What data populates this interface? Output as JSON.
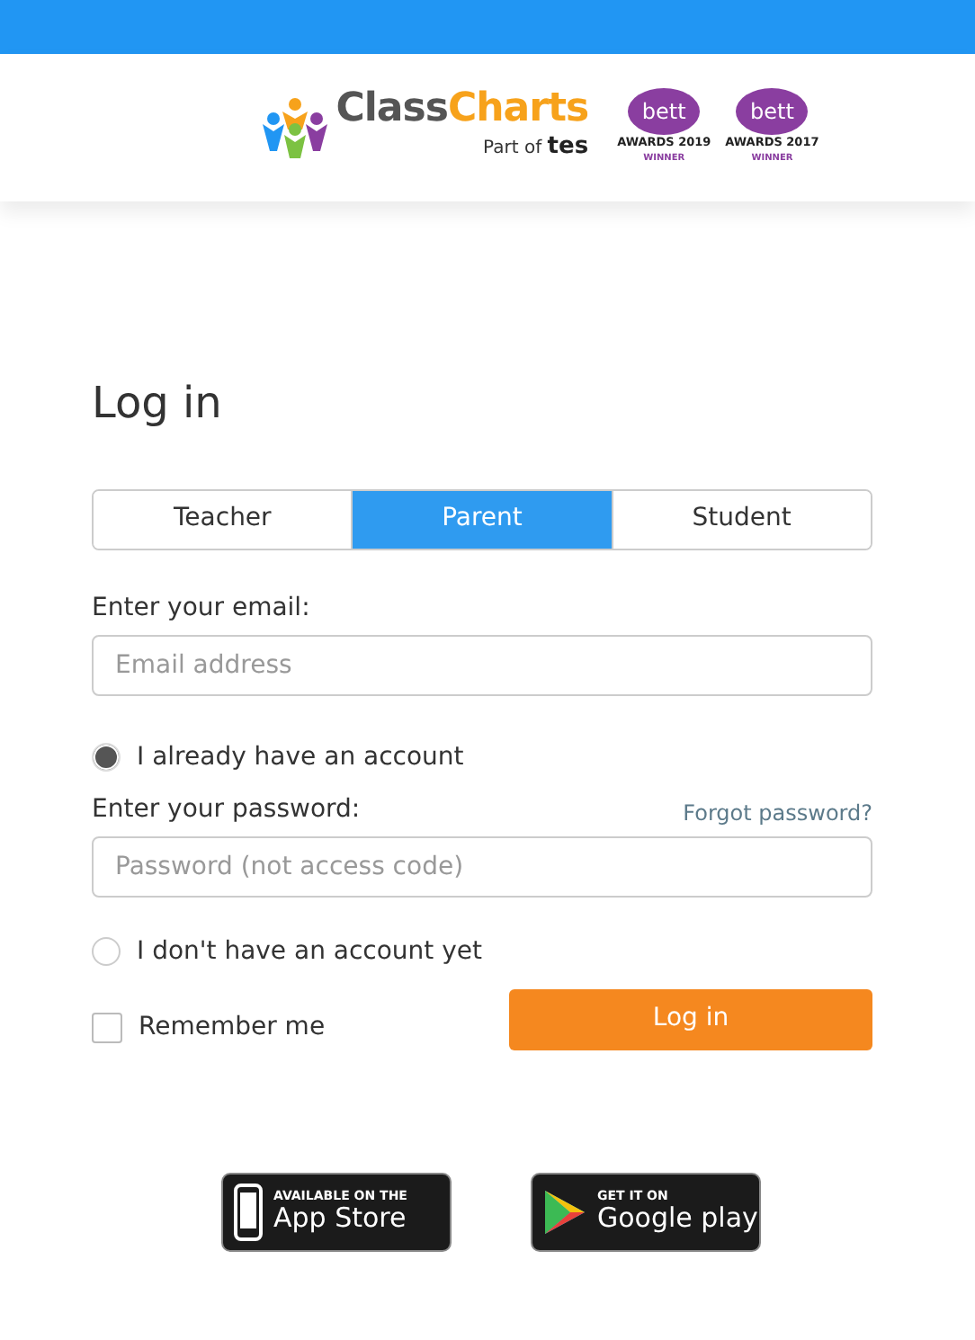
{
  "header": {
    "brand": [
      "Class",
      "Charts"
    ],
    "tagline": [
      "Part of",
      "tes"
    ],
    "awards": [
      {
        "name": "bett",
        "year": "AWARDS 2019",
        "note": "WINNER"
      },
      {
        "name": "bett",
        "year": "AWARDS 2017",
        "note": "WINNER"
      }
    ]
  },
  "title": "Log in",
  "tabs": [
    {
      "label": "Teacher",
      "selected": false
    },
    {
      "label": "Parent",
      "selected": true
    },
    {
      "label": "Student",
      "selected": false
    }
  ],
  "email": {
    "label": "Enter your email:",
    "placeholder": "Email address"
  },
  "account_options": [
    {
      "label": "I already have an account",
      "selected": true
    },
    {
      "label": "I don't have an account yet",
      "selected": false
    }
  ],
  "password": {
    "label": "Enter your password:",
    "link": "Forgot password?",
    "placeholder": "Password (not access code)"
  },
  "remember": {
    "label": "Remember me",
    "checked": false
  },
  "submit": "Log in",
  "stores": [
    {
      "kind": "apple",
      "small": "AVAILABLE ON THE",
      "big": "App Store"
    },
    {
      "kind": "google",
      "small": "GET IT ON",
      "big": "Google play"
    }
  ]
}
